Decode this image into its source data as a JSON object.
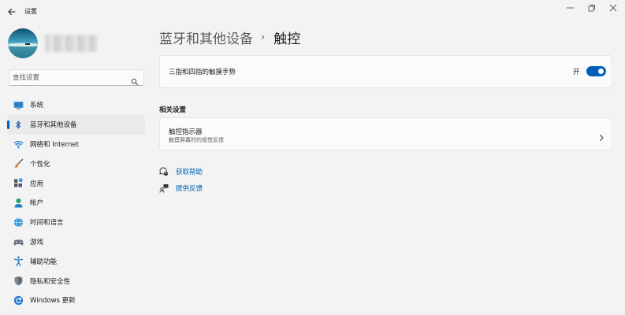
{
  "window": {
    "title": "设置",
    "controls": [
      "minimize-icon",
      "restore-icon",
      "close-icon"
    ]
  },
  "profile": {
    "avatar": "avatar-landscape",
    "name_blurred": true
  },
  "search": {
    "placeholder": "查找设置",
    "value": ""
  },
  "sidebar": {
    "items": [
      {
        "label": "系统",
        "icon": "system-icon",
        "active": false
      },
      {
        "label": "蓝牙和其他设备",
        "icon": "bluetooth-icon",
        "active": true
      },
      {
        "label": "网络和 Internet",
        "icon": "wifi-icon",
        "active": false
      },
      {
        "label": "个性化",
        "icon": "brush-icon",
        "active": false
      },
      {
        "label": "应用",
        "icon": "apps-icon",
        "active": false
      },
      {
        "label": "帐户",
        "icon": "account-icon",
        "active": false
      },
      {
        "label": "时间和语言",
        "icon": "time-language-icon",
        "active": false
      },
      {
        "label": "游戏",
        "icon": "gamepad-icon",
        "active": false
      },
      {
        "label": "辅助功能",
        "icon": "accessibility-icon",
        "active": false
      },
      {
        "label": "隐私和安全性",
        "icon": "shield-icon",
        "active": false
      },
      {
        "label": "Windows 更新",
        "icon": "update-icon",
        "active": false
      }
    ]
  },
  "breadcrumb": {
    "parent": "蓝牙和其他设备",
    "separator": "›",
    "current": "触控"
  },
  "touch_gesture": {
    "label": "三指和四指的触摸手势",
    "state_label": "开",
    "enabled": true
  },
  "related": {
    "title": "相关设置",
    "card": {
      "title": "触控指示器",
      "subtitle": "触摸屏幕时的视觉反馈"
    }
  },
  "links": [
    {
      "label": "获取帮助",
      "icon": "help-icon"
    },
    {
      "label": "提供反馈",
      "icon": "feedback-icon"
    }
  ],
  "colors": {
    "accent": "#005fb8",
    "background": "#f3f3f3",
    "card": "#fbfbfb"
  }
}
